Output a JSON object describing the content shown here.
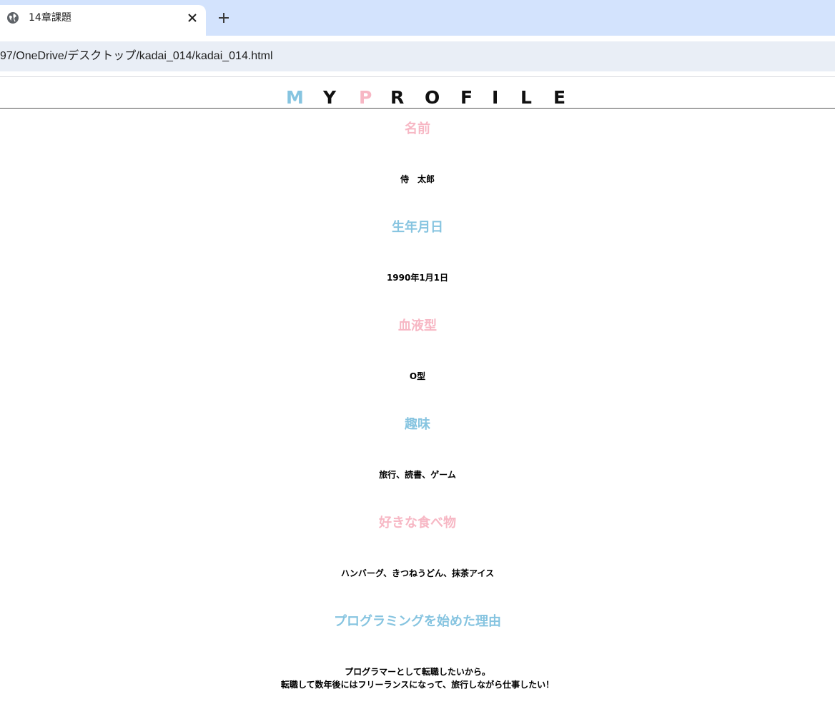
{
  "browser": {
    "tab_title": "14章課題",
    "url": "97/OneDrive/デスクトップ/kadai_014/kadai_014.html",
    "tab_close_icon": "close-icon",
    "new_tab_icon": "plus-icon",
    "favicon": "globe-icon"
  },
  "header": {
    "logo_letters": [
      "M",
      "Y",
      "P",
      "R",
      "O",
      "F",
      "I",
      "L",
      "E"
    ],
    "logo_colors": [
      "#86c4e0",
      "#111111",
      "#f7b7c4",
      "#111111",
      "#111111",
      "#111111",
      "#111111",
      "#111111",
      "#111111"
    ]
  },
  "colors": {
    "pink": "#f7b7c4",
    "blue": "#86c4e0"
  },
  "sections": [
    {
      "heading": "名前",
      "color": "pink",
      "lines": [
        "侍　太郎"
      ]
    },
    {
      "heading": "生年月日",
      "color": "blue",
      "lines": [
        "1990年1月1日"
      ]
    },
    {
      "heading": "血液型",
      "color": "pink",
      "lines": [
        "O型"
      ]
    },
    {
      "heading": "趣味",
      "color": "blue",
      "lines": [
        "旅行、読書、ゲーム"
      ]
    },
    {
      "heading": "好きな食べ物",
      "color": "pink",
      "lines": [
        "ハンバーグ、きつねうどん、抹茶アイス"
      ]
    },
    {
      "heading": "プログラミングを始めた理由",
      "color": "blue",
      "lines": [
        "プログラマーとして転職したいから。",
        "転職して数年後にはフリーランスになって、旅行しながら仕事したい！"
      ]
    }
  ]
}
